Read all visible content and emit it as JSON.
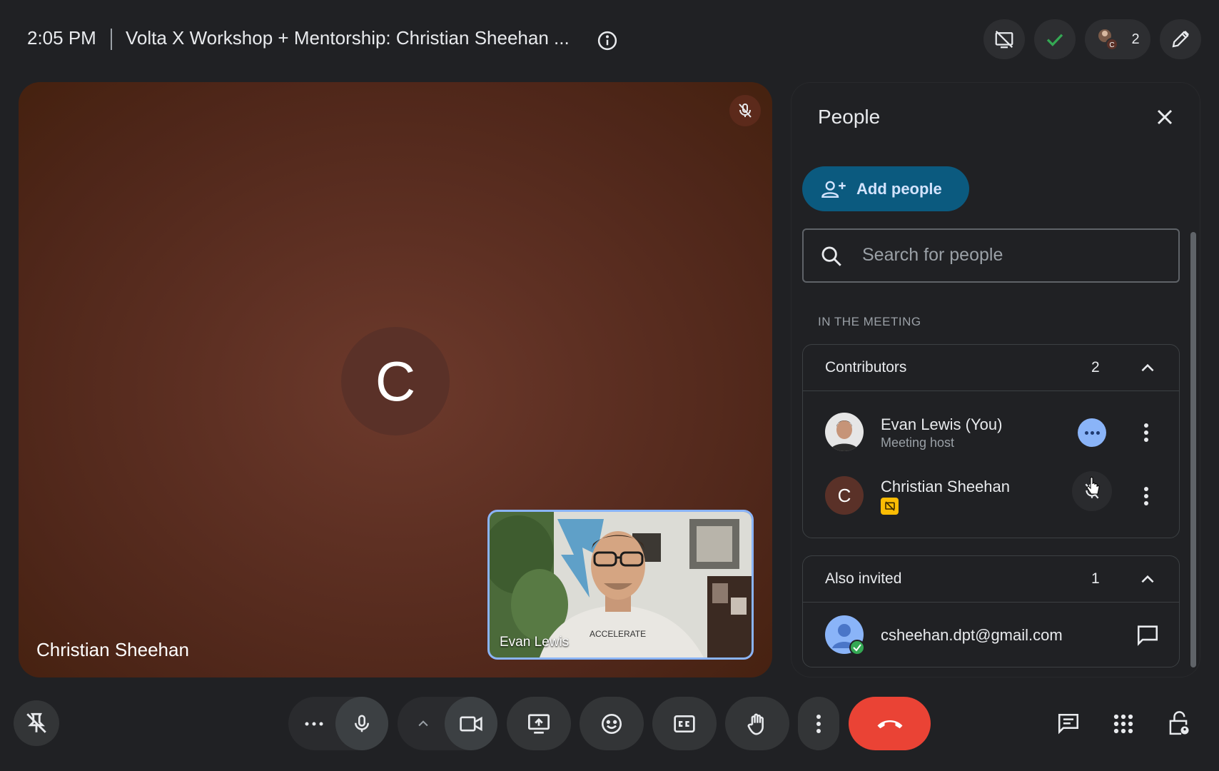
{
  "meeting": {
    "time": "2:05 PM",
    "title": "Volta X Workshop + Mentorship: Christian Sheehan ...",
    "participant_count": "2"
  },
  "stage": {
    "avatar_initial": "C",
    "name": "Christian Sheehan",
    "pip_name": "Evan Lewis"
  },
  "panel": {
    "title": "People",
    "add_people_label": "Add people",
    "search_placeholder": "Search for people",
    "in_meeting_label": "IN THE MEETING",
    "contributors": {
      "title": "Contributors",
      "count": "2",
      "people": [
        {
          "name": "Evan Lewis (You)",
          "role": "Meeting host"
        },
        {
          "name": "Christian Sheehan",
          "initial": "C"
        }
      ]
    },
    "also_invited": {
      "title": "Also invited",
      "count": "1",
      "people": [
        {
          "email": "csheehan.dpt@gmail.com"
        }
      ]
    }
  },
  "colors": {
    "accent": "#8ab4f8",
    "add_people_bg": "#0b5a7f",
    "end_call": "#ea4335",
    "stage_bg": "#5e3023",
    "presenting_badge": "#fbbc04"
  },
  "icons": {
    "top": [
      "info-icon",
      "no-present-icon",
      "check-icon",
      "participants-icon",
      "edit-icon"
    ],
    "bottom_left": [
      "pin-off-icon"
    ],
    "bottom_center": [
      "more-options-icon",
      "mic-icon",
      "chevron-up-icon",
      "camera-icon",
      "present-screen-icon",
      "emoji-icon",
      "captions-icon",
      "raise-hand-icon",
      "more-vert-icon",
      "end-call-icon"
    ],
    "bottom_right": [
      "chat-icon",
      "activities-icon",
      "host-controls-icon"
    ]
  }
}
